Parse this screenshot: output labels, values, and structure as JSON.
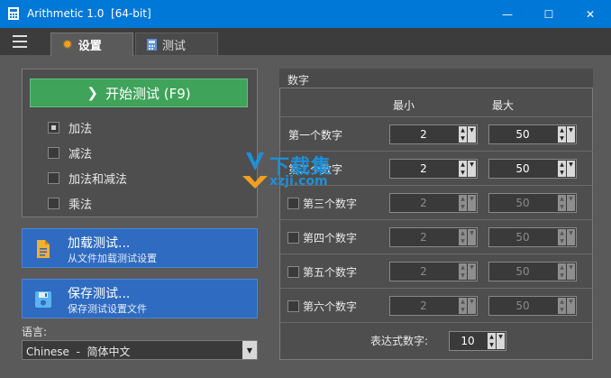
{
  "window": {
    "title": "Arithmetic 1.0  [64-bit]",
    "controls": {
      "minimize": "—",
      "maximize": "☐",
      "close": "✕"
    }
  },
  "tabs": [
    {
      "label": "设置",
      "icon": "gear-icon",
      "active": true
    },
    {
      "label": "测试",
      "icon": "calculator-icon",
      "active": false
    }
  ],
  "left": {
    "start_button": "开始测试 (F9)",
    "operations": [
      {
        "label": "加法",
        "checked": true
      },
      {
        "label": "减法",
        "checked": false
      },
      {
        "label": "加法和减法",
        "checked": false
      },
      {
        "label": "乘法",
        "checked": false
      }
    ],
    "load": {
      "title": "加载测试...",
      "subtitle": "从文件加载测试设置"
    },
    "save": {
      "title": "保存测试...",
      "subtitle": "保存测试设置文件"
    },
    "language_label": "语言:",
    "language_value": "Chinese  -  简体中文"
  },
  "numbers": {
    "header": "数字",
    "col_min": "最小",
    "col_max": "最大",
    "rows": [
      {
        "label": "第一个数字",
        "min": "2",
        "max": "50",
        "enabled": true,
        "has_checkbox": false
      },
      {
        "label": "第二个数字",
        "min": "2",
        "max": "50",
        "enabled": true,
        "has_checkbox": false
      },
      {
        "label": "第三个数字",
        "min": "2",
        "max": "50",
        "enabled": false,
        "has_checkbox": true
      },
      {
        "label": "第四个数字",
        "min": "2",
        "max": "50",
        "enabled": false,
        "has_checkbox": true
      },
      {
        "label": "第五个数字",
        "min": "2",
        "max": "50",
        "enabled": false,
        "has_checkbox": true
      },
      {
        "label": "第六个数字",
        "min": "2",
        "max": "50",
        "enabled": false,
        "has_checkbox": true
      }
    ],
    "expression_label": "表达式数字:",
    "expression_value": "10"
  },
  "watermark": {
    "big": "下载集",
    "small": "xzji.com"
  },
  "colors": {
    "titlebar": "#0078d7",
    "start": "#3fa35a",
    "blue_button": "#2f6bc0"
  }
}
